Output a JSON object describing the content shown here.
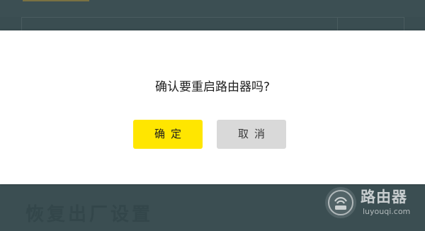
{
  "background": {
    "section_title": "恢复出厂设置"
  },
  "dialog": {
    "message": "确认要重启路由器吗?",
    "confirm_label": "确定",
    "cancel_label": "取消"
  },
  "watermark": {
    "title": "路由器",
    "subtitle": "luyouqi.com",
    "icon": "router-logo-icon"
  },
  "colors": {
    "confirm_button": "#ffe600",
    "cancel_button": "#d9d9d9",
    "backdrop": "#3a4d51"
  }
}
